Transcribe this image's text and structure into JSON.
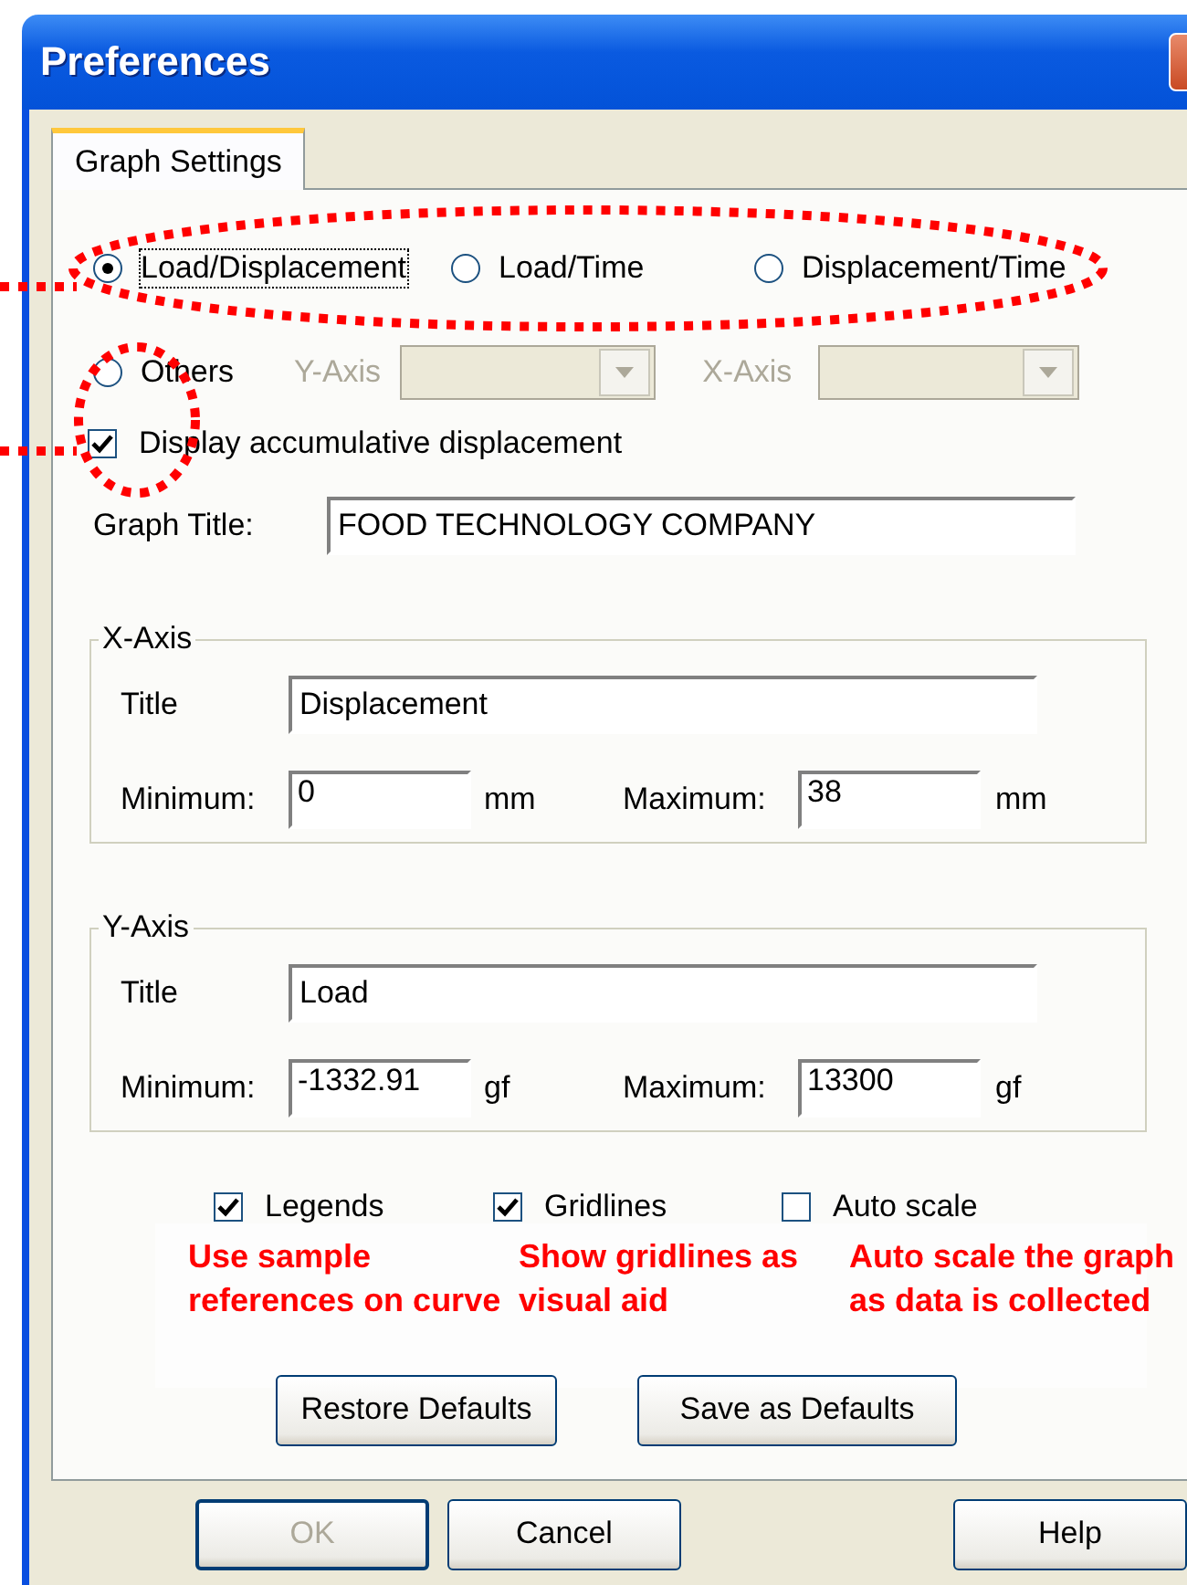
{
  "window": {
    "title": "Preferences"
  },
  "tabs": [
    {
      "label": "Graph Settings",
      "selected": true
    }
  ],
  "graph_types": [
    {
      "label": "Load/Displacement",
      "selected": true,
      "focused": true
    },
    {
      "label": "Load/Time",
      "selected": false,
      "focused": false
    },
    {
      "label": "Displacement/Time",
      "selected": false,
      "focused": false
    }
  ],
  "others": {
    "label": "Others",
    "selected": false
  },
  "axis_selects": [
    {
      "label": "Y-Axis",
      "disabled": true
    },
    {
      "label": "X-Axis",
      "disabled": true
    }
  ],
  "accumulative": {
    "label": "Display accumulative displacement",
    "checked": true
  },
  "graph_title": {
    "label": "Graph Title:",
    "value": "FOOD TECHNOLOGY COMPANY"
  },
  "axes": [
    {
      "legend": "X-Axis",
      "title_label": "Title",
      "title_value": "Displacement",
      "min_label": "Minimum:",
      "min_value": "0",
      "min_unit": "mm",
      "max_label": "Maximum:",
      "max_value": "38",
      "max_unit": "mm"
    },
    {
      "legend": "Y-Axis",
      "title_label": "Title",
      "title_value": "Load",
      "min_label": "Minimum:",
      "min_value": "-1332.91",
      "min_unit": "gf",
      "max_label": "Maximum:",
      "max_value": "13300",
      "max_unit": "gf"
    }
  ],
  "options": [
    {
      "label": "Legends",
      "checked": true
    },
    {
      "label": "Gridlines",
      "checked": true
    },
    {
      "label": "Auto scale",
      "checked": false
    }
  ],
  "notes": [
    "Use sample references on curve",
    "Show gridlines as visual aid",
    "Auto scale the graph as data is collected"
  ],
  "defaults_buttons": [
    "Restore Defaults",
    "Save as Defaults"
  ],
  "dialog_buttons": [
    {
      "label": "OK",
      "disabled": true,
      "kind": "default"
    },
    {
      "label": "Cancel",
      "disabled": false,
      "kind": "normal"
    },
    {
      "label": "Help",
      "disabled": false,
      "kind": "normal"
    }
  ]
}
